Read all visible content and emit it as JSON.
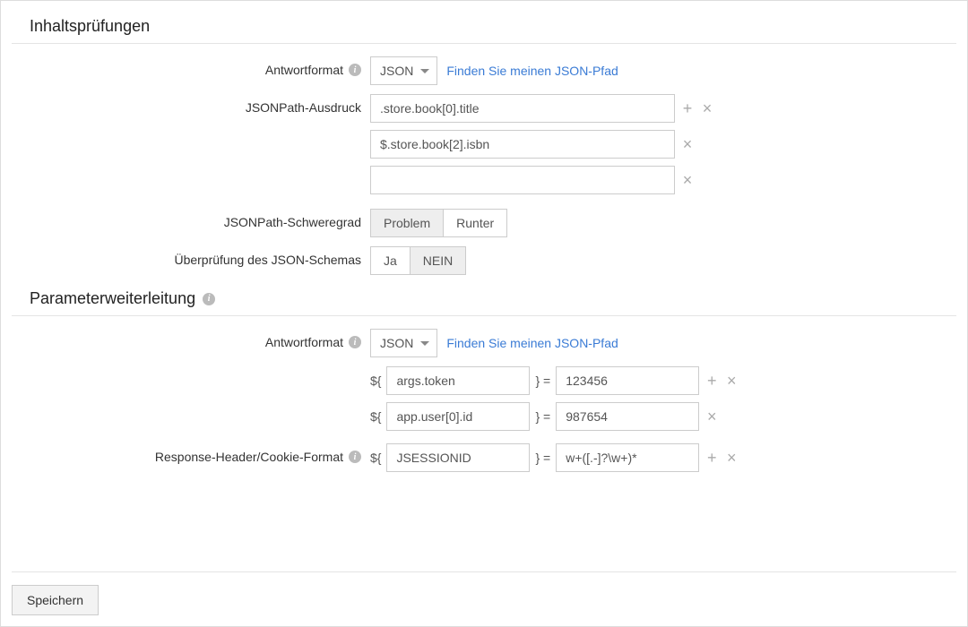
{
  "sections": {
    "content_checks": {
      "title": "Inhaltsprüfungen",
      "response_format": {
        "label": "Antwortformat",
        "value": "JSON",
        "link": "Finden Sie meinen JSON-Pfad"
      },
      "jsonpath_expression": {
        "label": "JSONPath-Ausdruck",
        "rows": [
          {
            "value": ".store.book[0].title",
            "has_add": true
          },
          {
            "value": "$.store.book[2].isbn",
            "has_add": false
          },
          {
            "value": "",
            "has_add": false
          }
        ]
      },
      "jsonpath_severity": {
        "label": "JSONPath-Schweregrad",
        "options": [
          "Problem",
          "Runter"
        ],
        "active": "Problem"
      },
      "schema_check": {
        "label": "Überprüfung des JSON-Schemas",
        "options": [
          "Ja",
          "NEIN"
        ],
        "active": "NEIN"
      }
    },
    "parameter_forwarding": {
      "title": "Parameterweiterleitung",
      "response_format": {
        "label": "Antwortformat",
        "value": "JSON",
        "link": "Finden Sie meinen JSON-Pfad"
      },
      "params": [
        {
          "key": "args.token",
          "value": "123456",
          "has_add": true
        },
        {
          "key": "app.user[0].id",
          "value": "987654",
          "has_add": false
        }
      ],
      "header_cookie": {
        "label": "Response-Header/Cookie-Format",
        "key": "JSESSIONID",
        "value": "w+([.-]?\\w+)*",
        "has_add": true
      }
    }
  },
  "glyphs": {
    "prefix": "${",
    "suffix_eq": "}  ="
  },
  "footer": {
    "save": "Speichern"
  }
}
